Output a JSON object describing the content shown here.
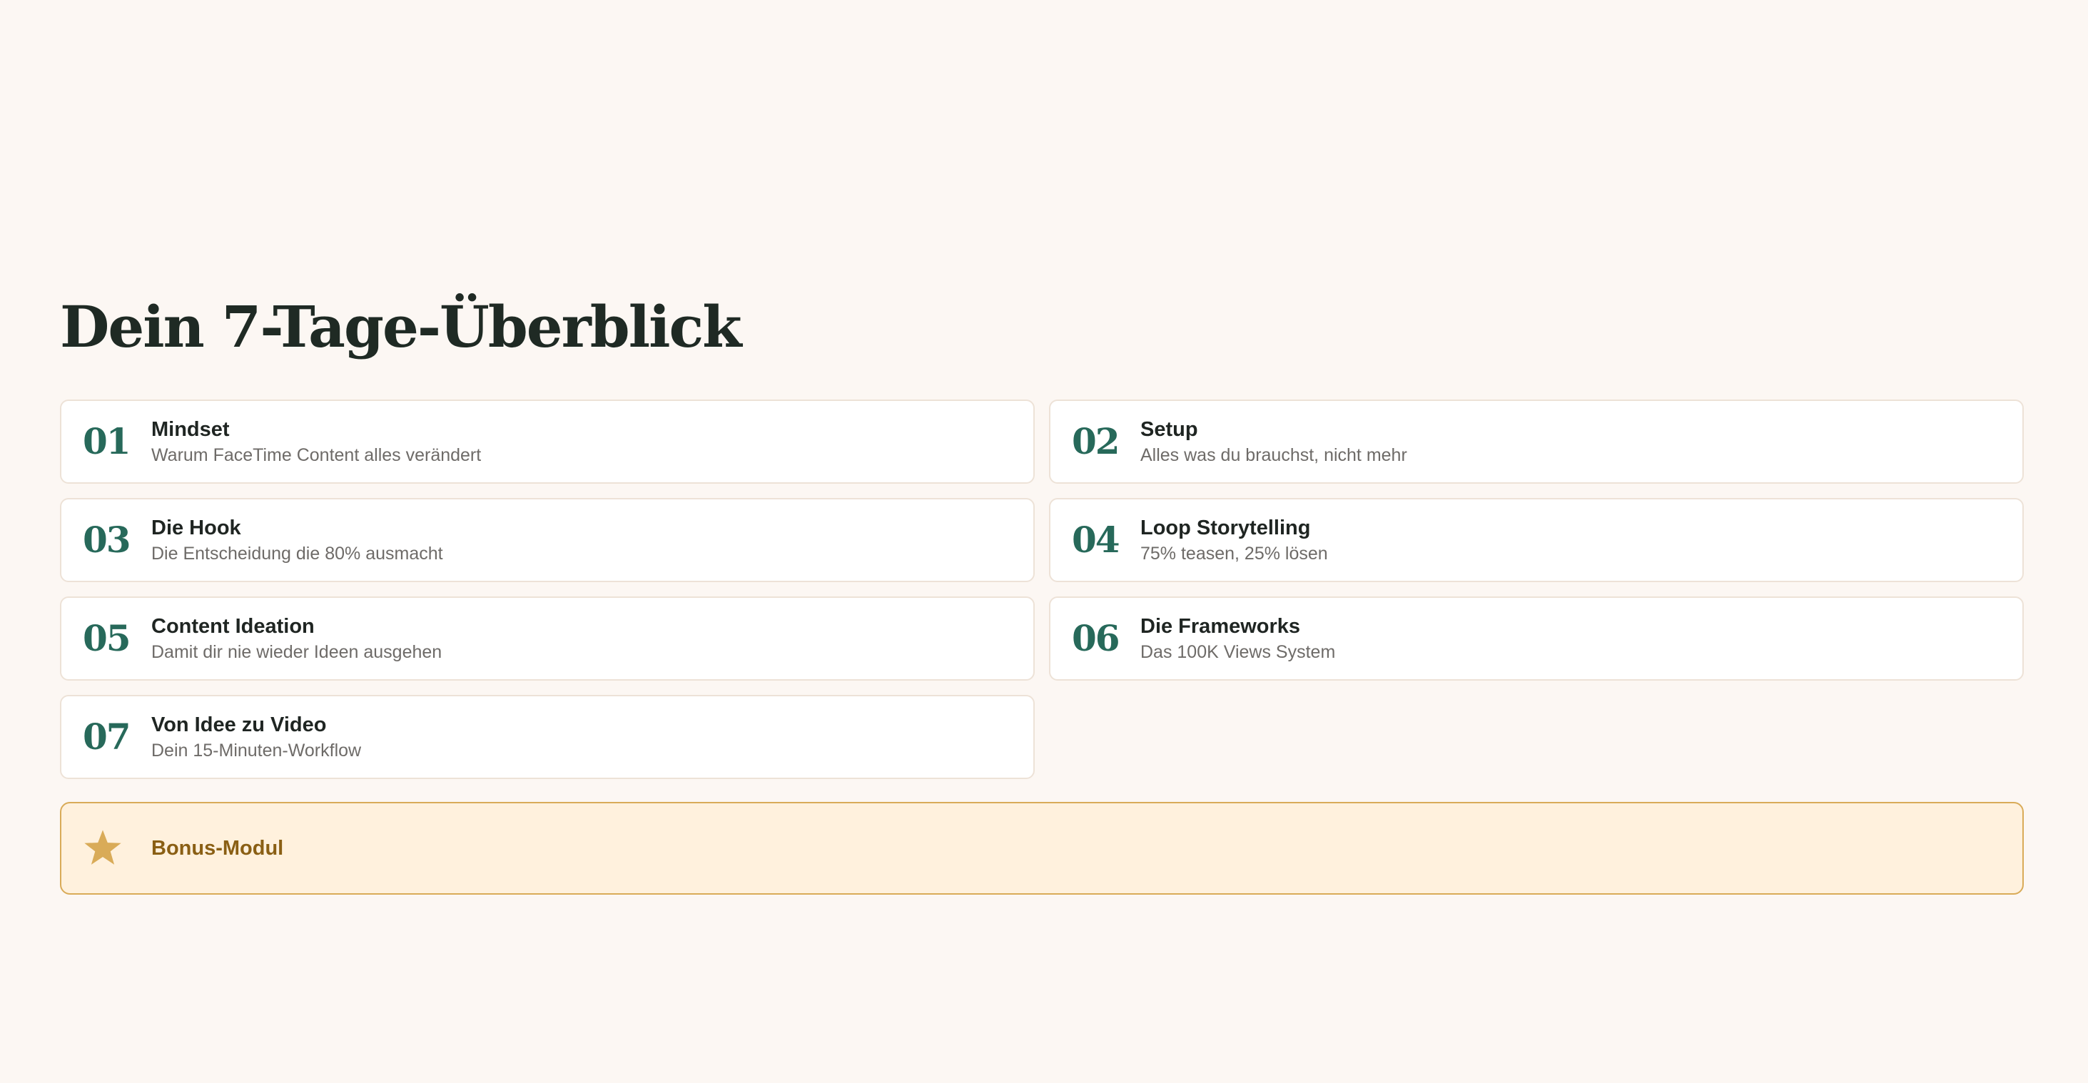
{
  "title": "Dein 7-Tage-Überblick",
  "colors": {
    "background": "#fcf7f3",
    "number_accent": "#27695a",
    "bonus_border": "#d9ab58",
    "bonus_background": "#fff1dd",
    "bonus_text": "#8a5f14"
  },
  "modules": [
    {
      "number": "01",
      "title": "Mindset",
      "subtitle": "Warum FaceTime Content alles verändert"
    },
    {
      "number": "02",
      "title": "Setup",
      "subtitle": "Alles was du brauchst, nicht mehr"
    },
    {
      "number": "03",
      "title": "Die Hook",
      "subtitle": "Die Entscheidung die 80% ausmacht"
    },
    {
      "number": "04",
      "title": "Loop Storytelling",
      "subtitle": "75% teasen, 25% lösen"
    },
    {
      "number": "05",
      "title": "Content Ideation",
      "subtitle": "Damit dir nie wieder Ideen ausgehen"
    },
    {
      "number": "06",
      "title": "Die Frameworks",
      "subtitle": "Das 100K Views System"
    },
    {
      "number": "07",
      "title": "Von Idee zu Video",
      "subtitle": "Dein 15-Minuten-Workflow"
    }
  ],
  "bonus": {
    "icon": "star-icon",
    "label": "Bonus-Modul"
  }
}
